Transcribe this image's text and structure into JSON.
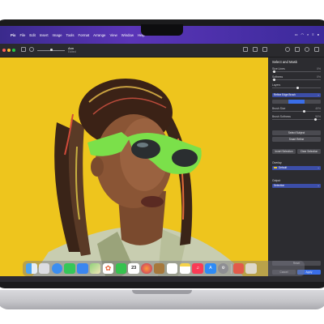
{
  "menubar": {
    "apple": "",
    "items": [
      "Pix",
      "File",
      "Edit",
      "Insert",
      "Image",
      "Tools",
      "Format",
      "Arrange",
      "View",
      "Window",
      "Help"
    ]
  },
  "toolbar": {
    "title": "Ann",
    "subtitle": "Edited"
  },
  "sidebar": {
    "title": "Select and Mask",
    "size_label": "Size Lines",
    "size_value": "0%",
    "softness_label": "Softness",
    "softness_value": "0%",
    "layer_label": "Layers",
    "layer_value": "",
    "refine_select": "Refine Edge Brush",
    "brush_size_label": "Brush Size",
    "brush_size_value": "40%",
    "brush_softness_label": "Brush Softness",
    "brush_softness_value": "50%",
    "select_subject": "Select Subject",
    "smart_refine": "Smart Refine",
    "invert_selection": "Invert Selection",
    "clear_selection": "Clear Selection",
    "overlay_label": "Overlay",
    "overlay_value": "Default",
    "output_label": "Output",
    "output_value": "Selection",
    "reset": "Reset",
    "cancel": "Cancel",
    "apply": "Apply"
  },
  "dock": {
    "items": [
      "finder",
      "launchpad",
      "safari",
      "messages",
      "mail",
      "maps",
      "photos",
      "facetime",
      "calendar",
      "pixelmator",
      "notes",
      "reminders",
      "notes-yellow",
      "music",
      "app-store",
      "settings",
      "folder",
      "trash"
    ],
    "calendar_day": "23"
  },
  "colors": {
    "canvas_bg": "#eec51d",
    "accent": "#3a6ee8",
    "menubar": "#5b35b8"
  }
}
